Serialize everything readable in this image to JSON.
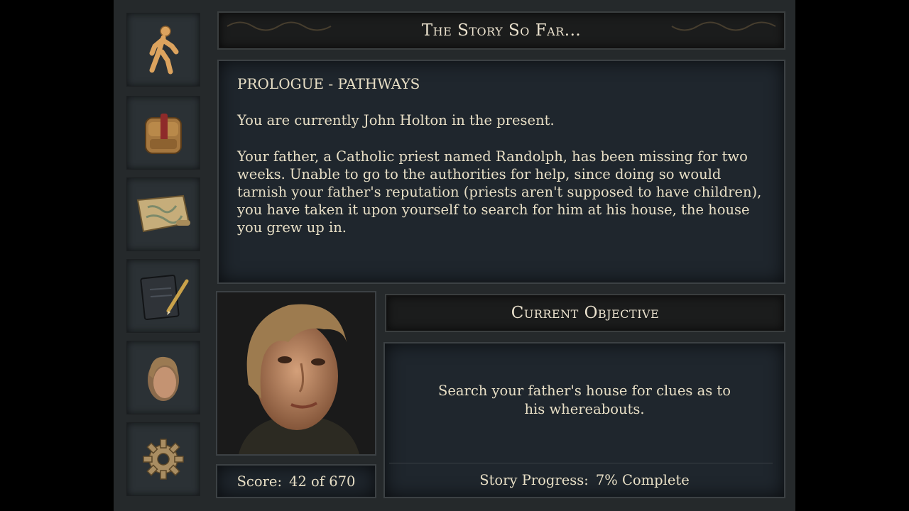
{
  "story": {
    "title": "The Story So Far...",
    "chapter": "PROLOGUE - PATHWAYS",
    "paragraph1": "You are currently John Holton in the present.",
    "paragraph2": "Your father, a Catholic priest named Randolph, has been missing for two weeks. Unable to go to the authorities for help, since doing so would tarnish your father's reputation (priests aren't supposed to have children), you have taken it upon yourself to search for him at his house, the house you grew up in."
  },
  "objective": {
    "title": "Current Objective",
    "text": "Search your father's house for clues as to his whereabouts."
  },
  "score": {
    "label": "Score:",
    "value": "42 of 670"
  },
  "progress": {
    "label": "Story Progress:",
    "value": "7% Complete"
  },
  "sidebar": {
    "items": [
      {
        "name": "walk",
        "icon": "walking-figure-icon"
      },
      {
        "name": "inventory",
        "icon": "backpack-icon"
      },
      {
        "name": "map",
        "icon": "map-scroll-icon"
      },
      {
        "name": "journal",
        "icon": "journal-pencil-icon"
      },
      {
        "name": "character",
        "icon": "portrait-icon"
      },
      {
        "name": "settings",
        "icon": "gear-icon"
      }
    ]
  },
  "colors": {
    "frame": "#25292b",
    "panel": "#1f262d",
    "text": "#e8dfc6",
    "accent": "#d9a35a"
  }
}
